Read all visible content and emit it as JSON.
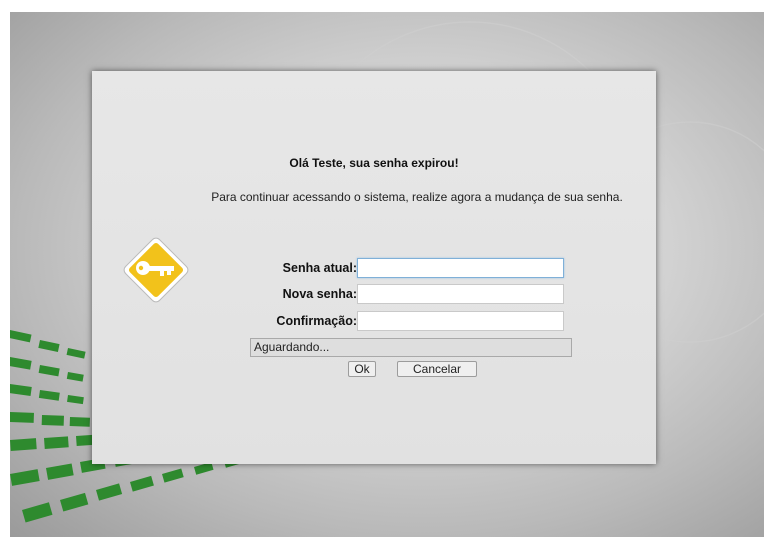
{
  "dialog": {
    "greeting": "Olá Teste, sua senha expirou!",
    "message": "Para continuar acessando o sistema, realize agora a mudança de sua senha.",
    "icon": "key-icon"
  },
  "form": {
    "current_password_label": "Senha atual:",
    "current_password_value": "",
    "new_password_label": "Nova senha:",
    "new_password_value": "",
    "confirm_label": "Confirmação:",
    "confirm_value": ""
  },
  "status": {
    "text": "Aguardando..."
  },
  "buttons": {
    "ok": "Ok",
    "cancel": "Cancelar"
  },
  "colors": {
    "accent_green": "#2e8a2e",
    "key_yellow": "#f2c21b"
  }
}
